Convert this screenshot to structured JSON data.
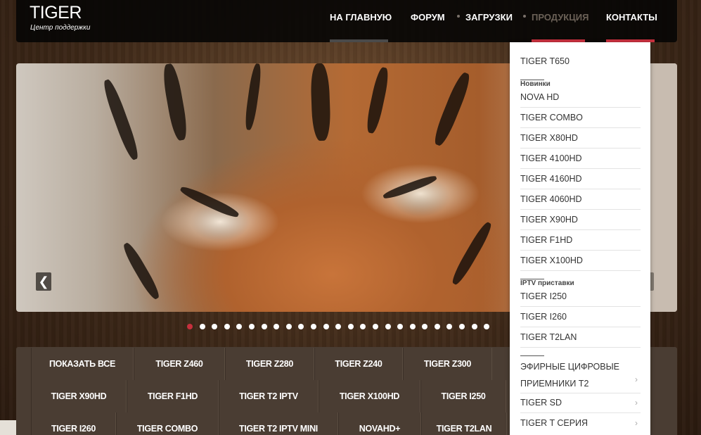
{
  "logo": {
    "title": "TIGER",
    "subtitle": "Центр поддержки"
  },
  "nav": {
    "home": "НА ГЛАВНУЮ",
    "forum": "ФОРУМ",
    "downloads": "ЗАГРУЗКИ",
    "products": "ПРОДУКЦИЯ",
    "contacts": "КОНТАКТЫ"
  },
  "colors": {
    "accent": "#c6303d",
    "nav_bg": "#080605",
    "filter_bg": "#4a3d33"
  },
  "slider": {
    "prev_icon": "chevron-left-icon",
    "dots_count": 25,
    "active_dot": 1
  },
  "filters": {
    "row1": [
      "ПОКАЗАТЬ ВСЕ",
      "TIGER Z460",
      "TIGER Z280",
      "TIGER Z240",
      "TIGER Z300"
    ],
    "row2": [
      "TIGER X90HD",
      "TIGER F1HD",
      "TIGER T2 IPTV",
      "TIGER X100HD",
      "TIGER I250"
    ],
    "row3": [
      "TIGER I260",
      "TIGER COMBO",
      "TIGER T2 IPTV MINI",
      "NOVAHD+",
      "TIGER T2LAN"
    ]
  },
  "dropdown": {
    "top_item": "TIGER T650",
    "group_new": "Новинки",
    "new_items": [
      "NOVA HD",
      "TIGER COMBO",
      "TIGER X80HD",
      "TIGER 4100HD",
      "TIGER 4160HD",
      "TIGER 4060HD",
      "TIGER X90HD",
      "TIGER F1HD",
      "TIGER X100HD"
    ],
    "group_iptv": "IPTV приставки",
    "iptv_items": [
      "TIGER I250",
      "TIGER I260",
      "TIGER T2LAN"
    ],
    "submenus": [
      "ЭФИРНЫЕ ЦИФРОВЫЕ ПРИЕМНИКИ Т2",
      "TIGER SD",
      "TIGER T СЕРИЯ"
    ]
  }
}
